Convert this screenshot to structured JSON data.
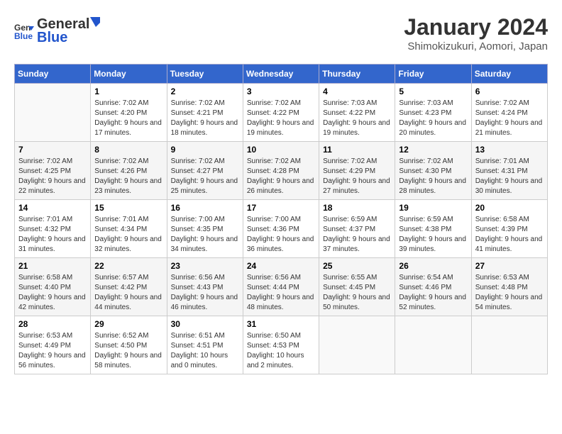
{
  "header": {
    "logo_general": "General",
    "logo_blue": "Blue",
    "month": "January 2024",
    "location": "Shimokizukuri, Aomori, Japan"
  },
  "weekdays": [
    "Sunday",
    "Monday",
    "Tuesday",
    "Wednesday",
    "Thursday",
    "Friday",
    "Saturday"
  ],
  "weeks": [
    [
      {
        "day": "",
        "sunrise": "",
        "sunset": "",
        "daylight": ""
      },
      {
        "day": "1",
        "sunrise": "7:02 AM",
        "sunset": "4:20 PM",
        "daylight": "9 hours and 17 minutes."
      },
      {
        "day": "2",
        "sunrise": "7:02 AM",
        "sunset": "4:21 PM",
        "daylight": "9 hours and 18 minutes."
      },
      {
        "day": "3",
        "sunrise": "7:02 AM",
        "sunset": "4:22 PM",
        "daylight": "9 hours and 19 minutes."
      },
      {
        "day": "4",
        "sunrise": "7:03 AM",
        "sunset": "4:22 PM",
        "daylight": "9 hours and 19 minutes."
      },
      {
        "day": "5",
        "sunrise": "7:03 AM",
        "sunset": "4:23 PM",
        "daylight": "9 hours and 20 minutes."
      },
      {
        "day": "6",
        "sunrise": "7:02 AM",
        "sunset": "4:24 PM",
        "daylight": "9 hours and 21 minutes."
      }
    ],
    [
      {
        "day": "7",
        "sunrise": "7:02 AM",
        "sunset": "4:25 PM",
        "daylight": "9 hours and 22 minutes."
      },
      {
        "day": "8",
        "sunrise": "7:02 AM",
        "sunset": "4:26 PM",
        "daylight": "9 hours and 23 minutes."
      },
      {
        "day": "9",
        "sunrise": "7:02 AM",
        "sunset": "4:27 PM",
        "daylight": "9 hours and 25 minutes."
      },
      {
        "day": "10",
        "sunrise": "7:02 AM",
        "sunset": "4:28 PM",
        "daylight": "9 hours and 26 minutes."
      },
      {
        "day": "11",
        "sunrise": "7:02 AM",
        "sunset": "4:29 PM",
        "daylight": "9 hours and 27 minutes."
      },
      {
        "day": "12",
        "sunrise": "7:02 AM",
        "sunset": "4:30 PM",
        "daylight": "9 hours and 28 minutes."
      },
      {
        "day": "13",
        "sunrise": "7:01 AM",
        "sunset": "4:31 PM",
        "daylight": "9 hours and 30 minutes."
      }
    ],
    [
      {
        "day": "14",
        "sunrise": "7:01 AM",
        "sunset": "4:32 PM",
        "daylight": "9 hours and 31 minutes."
      },
      {
        "day": "15",
        "sunrise": "7:01 AM",
        "sunset": "4:34 PM",
        "daylight": "9 hours and 32 minutes."
      },
      {
        "day": "16",
        "sunrise": "7:00 AM",
        "sunset": "4:35 PM",
        "daylight": "9 hours and 34 minutes."
      },
      {
        "day": "17",
        "sunrise": "7:00 AM",
        "sunset": "4:36 PM",
        "daylight": "9 hours and 36 minutes."
      },
      {
        "day": "18",
        "sunrise": "6:59 AM",
        "sunset": "4:37 PM",
        "daylight": "9 hours and 37 minutes."
      },
      {
        "day": "19",
        "sunrise": "6:59 AM",
        "sunset": "4:38 PM",
        "daylight": "9 hours and 39 minutes."
      },
      {
        "day": "20",
        "sunrise": "6:58 AM",
        "sunset": "4:39 PM",
        "daylight": "9 hours and 41 minutes."
      }
    ],
    [
      {
        "day": "21",
        "sunrise": "6:58 AM",
        "sunset": "4:40 PM",
        "daylight": "9 hours and 42 minutes."
      },
      {
        "day": "22",
        "sunrise": "6:57 AM",
        "sunset": "4:42 PM",
        "daylight": "9 hours and 44 minutes."
      },
      {
        "day": "23",
        "sunrise": "6:56 AM",
        "sunset": "4:43 PM",
        "daylight": "9 hours and 46 minutes."
      },
      {
        "day": "24",
        "sunrise": "6:56 AM",
        "sunset": "4:44 PM",
        "daylight": "9 hours and 48 minutes."
      },
      {
        "day": "25",
        "sunrise": "6:55 AM",
        "sunset": "4:45 PM",
        "daylight": "9 hours and 50 minutes."
      },
      {
        "day": "26",
        "sunrise": "6:54 AM",
        "sunset": "4:46 PM",
        "daylight": "9 hours and 52 minutes."
      },
      {
        "day": "27",
        "sunrise": "6:53 AM",
        "sunset": "4:48 PM",
        "daylight": "9 hours and 54 minutes."
      }
    ],
    [
      {
        "day": "28",
        "sunrise": "6:53 AM",
        "sunset": "4:49 PM",
        "daylight": "9 hours and 56 minutes."
      },
      {
        "day": "29",
        "sunrise": "6:52 AM",
        "sunset": "4:50 PM",
        "daylight": "9 hours and 58 minutes."
      },
      {
        "day": "30",
        "sunrise": "6:51 AM",
        "sunset": "4:51 PM",
        "daylight": "10 hours and 0 minutes."
      },
      {
        "day": "31",
        "sunrise": "6:50 AM",
        "sunset": "4:53 PM",
        "daylight": "10 hours and 2 minutes."
      },
      {
        "day": "",
        "sunrise": "",
        "sunset": "",
        "daylight": ""
      },
      {
        "day": "",
        "sunrise": "",
        "sunset": "",
        "daylight": ""
      },
      {
        "day": "",
        "sunrise": "",
        "sunset": "",
        "daylight": ""
      }
    ]
  ],
  "labels": {
    "sunrise": "Sunrise:",
    "sunset": "Sunset:",
    "daylight": "Daylight:"
  }
}
